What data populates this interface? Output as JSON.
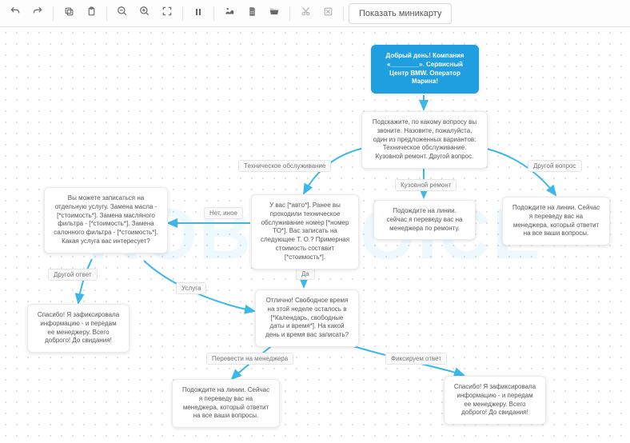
{
  "toolbar": {
    "undo": "undo",
    "redo": "redo",
    "copy": "copy",
    "paste": "paste",
    "zoom_out": "zoom-out",
    "zoom_in": "zoom-in",
    "fit": "fit-screen",
    "pause": "pause",
    "export_img": "export-image",
    "export_doc": "export-doc",
    "open": "open",
    "cut": "cut",
    "delete": "delete",
    "minimap_label": "Показать миникарту"
  },
  "watermark": "ROBOVOICE",
  "edge_labels": {
    "e_tech": "Техническое обслуживание",
    "e_body": "Кузовной ремонт",
    "e_other": "Другой вопрос",
    "e_no": "Нет, иное",
    "e_yes": "Да",
    "e_other_ans": "Другой ответ",
    "e_service": "Услуга",
    "e_manager": "Перевести на менеджера",
    "e_fix": "Фиксируем ответ"
  },
  "chart_data": {
    "type": "flowchart",
    "nodes": [
      {
        "id": "start",
        "kind": "start",
        "text": "Добрый день! Компания «________». Сервисный Центр BMW. Оператор Марина!"
      },
      {
        "id": "ask",
        "text": "Подскажите, по какому вопросу вы звоните. Назовите, пожалуйста, один из предложенных вариантов: Техническое обслуживание. Кузовной ремонт. Другой вопрос."
      },
      {
        "id": "tech",
        "text": "У вас [*авто*]. Ранее вы проходили техническое обслуживание номер [*номер ТО*]. Вас записать на следующее Т. О.? Примерная стоимость составит [*стоимость*]."
      },
      {
        "id": "body",
        "text": "Подождите на линии. сейчас я переведу вас на менеджера по ремонту."
      },
      {
        "id": "otherq",
        "text": "Подождите на линии. Сейчас я переведу вас на менеджера, который ответит на все ваши вопросы."
      },
      {
        "id": "no_other",
        "text": "Вы можете записаться на отдельную услугу. Замена масла - [*стоимость*]. Замена масляного фильтра - [*стоимость*]. Замена салонного фильтра - [*стоимость*]. Какая услуга вас интересует?"
      },
      {
        "id": "sched",
        "text": "Отлично! Свободное время на этой неделе осталось в [*Календарь, свободные даты и время*]. На какой день и время вас записать?"
      },
      {
        "id": "thanks1",
        "text": "Спасибо! Я зафиксировала информацию - и передам ее менеджеру. Всего доброго! До свидания!"
      },
      {
        "id": "tomgr",
        "text": "Подождите на линии. Сейчас я переведу вас на менеджера, который ответит на все ваши вопросы."
      },
      {
        "id": "thanks2",
        "text": "Спасибо! Я зафиксировала информацию - и передам ее менеджеру. Всего доброго! До свидания!"
      }
    ],
    "edges": [
      {
        "from": "start",
        "to": "ask"
      },
      {
        "from": "ask",
        "to": "tech",
        "label": "Техническое обслуживание"
      },
      {
        "from": "ask",
        "to": "body",
        "label": "Кузовной ремонт"
      },
      {
        "from": "ask",
        "to": "otherq",
        "label": "Другой вопрос"
      },
      {
        "from": "tech",
        "to": "no_other",
        "label": "Нет, иное"
      },
      {
        "from": "tech",
        "to": "sched",
        "label": "Да"
      },
      {
        "from": "no_other",
        "to": "thanks1",
        "label": "Другой ответ"
      },
      {
        "from": "no_other",
        "to": "sched",
        "label": "Услуга"
      },
      {
        "from": "sched",
        "to": "tomgr",
        "label": "Перевести на менеджера"
      },
      {
        "from": "sched",
        "to": "thanks2",
        "label": "Фиксируем ответ"
      }
    ]
  }
}
